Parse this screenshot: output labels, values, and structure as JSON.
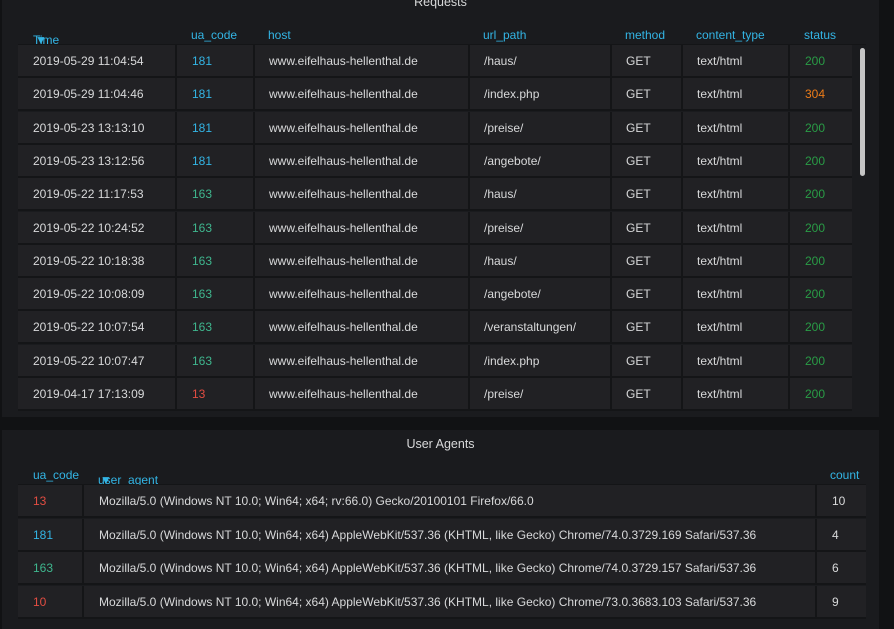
{
  "requests_panel": {
    "title": "Requests",
    "columns": [
      "Time",
      "ua_code",
      "host",
      "url_path",
      "method",
      "content_type",
      "status"
    ],
    "sort_column": "Time",
    "rows": [
      {
        "time": "2019-05-29 11:04:54",
        "ua_code": "181",
        "ua_color": "#33b5e5",
        "host": "www.eifelhaus-hellenthal.de",
        "url_path": "/haus/",
        "method": "GET",
        "content_type": "text/html",
        "status": "200",
        "status_color": "#299c46"
      },
      {
        "time": "2019-05-29 11:04:46",
        "ua_code": "181",
        "ua_color": "#33b5e5",
        "host": "www.eifelhaus-hellenthal.de",
        "url_path": "/index.php",
        "method": "GET",
        "content_type": "text/html",
        "status": "304",
        "status_color": "#eb7b18"
      },
      {
        "time": "2019-05-23 13:13:10",
        "ua_code": "181",
        "ua_color": "#33b5e5",
        "host": "www.eifelhaus-hellenthal.de",
        "url_path": "/preise/",
        "method": "GET",
        "content_type": "text/html",
        "status": "200",
        "status_color": "#299c46"
      },
      {
        "time": "2019-05-23 13:12:56",
        "ua_code": "181",
        "ua_color": "#33b5e5",
        "host": "www.eifelhaus-hellenthal.de",
        "url_path": "/angebote/",
        "method": "GET",
        "content_type": "text/html",
        "status": "200",
        "status_color": "#299c46"
      },
      {
        "time": "2019-05-22 11:17:53",
        "ua_code": "163",
        "ua_color": "#3fb68e",
        "host": "www.eifelhaus-hellenthal.de",
        "url_path": "/haus/",
        "method": "GET",
        "content_type": "text/html",
        "status": "200",
        "status_color": "#299c46"
      },
      {
        "time": "2019-05-22 10:24:52",
        "ua_code": "163",
        "ua_color": "#3fb68e",
        "host": "www.eifelhaus-hellenthal.de",
        "url_path": "/preise/",
        "method": "GET",
        "content_type": "text/html",
        "status": "200",
        "status_color": "#299c46"
      },
      {
        "time": "2019-05-22 10:18:38",
        "ua_code": "163",
        "ua_color": "#3fb68e",
        "host": "www.eifelhaus-hellenthal.de",
        "url_path": "/haus/",
        "method": "GET",
        "content_type": "text/html",
        "status": "200",
        "status_color": "#299c46"
      },
      {
        "time": "2019-05-22 10:08:09",
        "ua_code": "163",
        "ua_color": "#3fb68e",
        "host": "www.eifelhaus-hellenthal.de",
        "url_path": "/angebote/",
        "method": "GET",
        "content_type": "text/html",
        "status": "200",
        "status_color": "#299c46"
      },
      {
        "time": "2019-05-22 10:07:54",
        "ua_code": "163",
        "ua_color": "#3fb68e",
        "host": "www.eifelhaus-hellenthal.de",
        "url_path": "/veranstaltungen/",
        "method": "GET",
        "content_type": "text/html",
        "status": "200",
        "status_color": "#299c46"
      },
      {
        "time": "2019-05-22 10:07:47",
        "ua_code": "163",
        "ua_color": "#3fb68e",
        "host": "www.eifelhaus-hellenthal.de",
        "url_path": "/index.php",
        "method": "GET",
        "content_type": "text/html",
        "status": "200",
        "status_color": "#299c46"
      },
      {
        "time": "2019-04-17 17:13:09",
        "ua_code": "13",
        "ua_color": "#e24d42",
        "host": "www.eifelhaus-hellenthal.de",
        "url_path": "/preise/",
        "method": "GET",
        "content_type": "text/html",
        "status": "200",
        "status_color": "#299c46"
      }
    ]
  },
  "user_agents_panel": {
    "title": "User Agents",
    "columns": [
      "ua_code",
      "user_agent",
      "count"
    ],
    "sort_column": "user_agent",
    "rows": [
      {
        "ua_code": "13",
        "ua_color": "#e24d42",
        "user_agent": "Mozilla/5.0 (Windows NT 10.0; Win64; x64; rv:66.0) Gecko/20100101 Firefox/66.0",
        "count": "10"
      },
      {
        "ua_code": "181",
        "ua_color": "#33b5e5",
        "user_agent": "Mozilla/5.0 (Windows NT 10.0; Win64; x64) AppleWebKit/537.36 (KHTML, like Gecko) Chrome/74.0.3729.169 Safari/537.36",
        "count": "4"
      },
      {
        "ua_code": "163",
        "ua_color": "#3fb68e",
        "user_agent": "Mozilla/5.0 (Windows NT 10.0; Win64; x64) AppleWebKit/537.36 (KHTML, like Gecko) Chrome/74.0.3729.157 Safari/537.36",
        "count": "6"
      },
      {
        "ua_code": "10",
        "ua_color": "#e24d42",
        "user_agent": "Mozilla/5.0 (Windows NT 10.0; Win64; x64) AppleWebKit/537.36 (KHTML, like Gecko) Chrome/73.0.3683.103 Safari/537.36",
        "count": "9"
      }
    ]
  }
}
